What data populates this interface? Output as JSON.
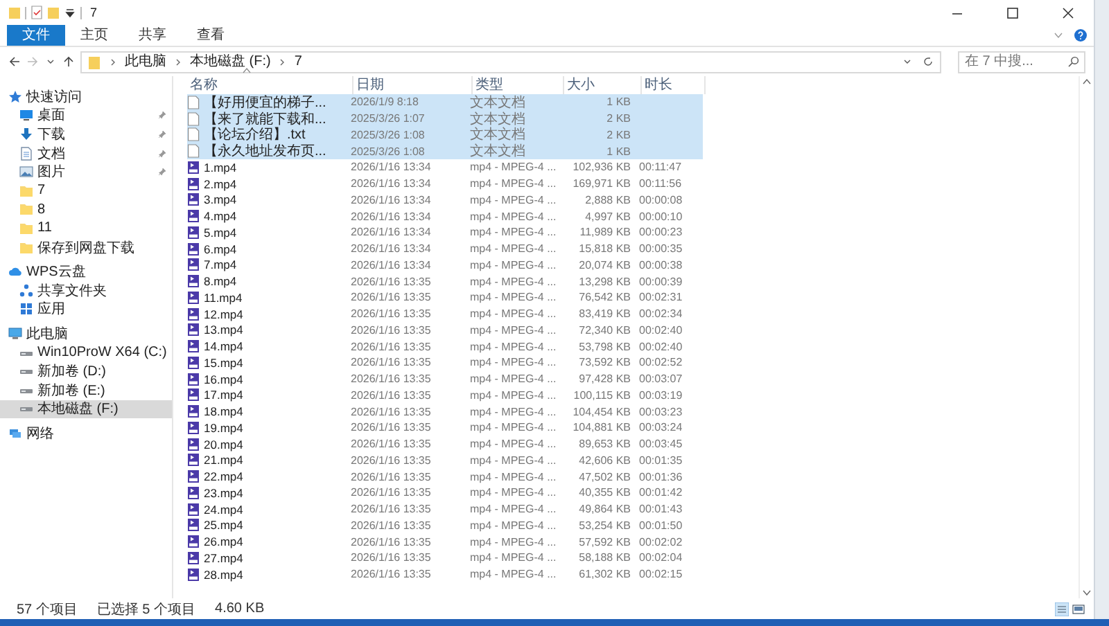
{
  "window": {
    "title": "7"
  },
  "ribbon_tabs": [
    {
      "label": "文件",
      "selected": true
    },
    {
      "label": "主页",
      "selected": false
    },
    {
      "label": "共享",
      "selected": false
    },
    {
      "label": "查看",
      "selected": false
    }
  ],
  "address": {
    "crumbs": [
      "此电脑",
      "本地磁盘 (F:)",
      "7"
    ]
  },
  "search": {
    "placeholder": "在 7 中搜..."
  },
  "sidebar": {
    "items": [
      {
        "label": "快速访问",
        "selected": false,
        "children": [
          {
            "label": "桌面",
            "pinned": true,
            "selected": false
          },
          {
            "label": "下载",
            "pinned": true,
            "selected": false
          },
          {
            "label": "文档",
            "pinned": true,
            "selected": false
          },
          {
            "label": "图片",
            "pinned": true,
            "selected": false
          },
          {
            "label": "7",
            "pinned": false,
            "selected": false
          },
          {
            "label": "8",
            "pinned": false,
            "selected": false
          },
          {
            "label": "11",
            "pinned": false,
            "selected": false
          },
          {
            "label": "保存到网盘下载",
            "pinned": false,
            "selected": false
          }
        ]
      },
      {
        "label": "WPS云盘",
        "selected": false,
        "children": [
          {
            "label": "共享文件夹",
            "pinned": false,
            "selected": false
          },
          {
            "label": "应用",
            "pinned": false,
            "selected": false
          }
        ]
      },
      {
        "label": "此电脑",
        "selected": false,
        "children": [
          {
            "label": "Win10ProW X64 (C:)",
            "pinned": false,
            "selected": false
          },
          {
            "label": "新加卷 (D:)",
            "pinned": false,
            "selected": false
          },
          {
            "label": "新加卷 (E:)",
            "pinned": false,
            "selected": false
          },
          {
            "label": "本地磁盘 (F:)",
            "pinned": false,
            "selected": true
          }
        ]
      },
      {
        "label": "网络",
        "selected": false
      }
    ]
  },
  "table": {
    "columns": [
      "名称",
      "日期",
      "类型",
      "大小",
      "时长"
    ],
    "rows": [
      {
        "kind": "text",
        "selected": true,
        "name": "【好用便宜的梯子...",
        "date": "2026/1/9 8:18",
        "type": "文本文档",
        "size": "1 KB"
      },
      {
        "kind": "text",
        "selected": true,
        "name": "【来了就能下载和...",
        "date": "2025/3/26 1:07",
        "type": "文本文档",
        "size": "2 KB"
      },
      {
        "kind": "text",
        "selected": true,
        "name": "【论坛介绍】.txt",
        "date": "2025/3/26 1:08",
        "type": "文本文档",
        "size": "2 KB"
      },
      {
        "kind": "text",
        "selected": true,
        "name": "【永久地址发布页...",
        "date": "2025/3/26 1:08",
        "type": "文本文档",
        "size": "1 KB"
      },
      {
        "kind": "video",
        "selected": false,
        "name": "1.mp4",
        "date": "2026/1/16 13:34",
        "type": "mp4 - MPEG-4 ...",
        "size": "102,936 KB",
        "duration": "00:11:47"
      },
      {
        "kind": "video",
        "selected": false,
        "name": "2.mp4",
        "date": "2026/1/16 13:34",
        "type": "mp4 - MPEG-4 ...",
        "size": "169,971 KB",
        "duration": "00:11:56"
      },
      {
        "kind": "video",
        "selected": false,
        "name": "3.mp4",
        "date": "2026/1/16 13:34",
        "type": "mp4 - MPEG-4 ...",
        "size": "2,888 KB",
        "duration": "00:00:08"
      },
      {
        "kind": "video",
        "selected": false,
        "name": "4.mp4",
        "date": "2026/1/16 13:34",
        "type": "mp4 - MPEG-4 ...",
        "size": "4,997 KB",
        "duration": "00:00:10"
      },
      {
        "kind": "video",
        "selected": false,
        "name": "5.mp4",
        "date": "2026/1/16 13:34",
        "type": "mp4 - MPEG-4 ...",
        "size": "11,989 KB",
        "duration": "00:00:23"
      },
      {
        "kind": "video",
        "selected": false,
        "name": "6.mp4",
        "date": "2026/1/16 13:34",
        "type": "mp4 - MPEG-4 ...",
        "size": "15,818 KB",
        "duration": "00:00:35"
      },
      {
        "kind": "video",
        "selected": false,
        "name": "7.mp4",
        "date": "2026/1/16 13:34",
        "type": "mp4 - MPEG-4 ...",
        "size": "20,074 KB",
        "duration": "00:00:38"
      },
      {
        "kind": "video",
        "selected": false,
        "name": "8.mp4",
        "date": "2026/1/16 13:35",
        "type": "mp4 - MPEG-4 ...",
        "size": "13,298 KB",
        "duration": "00:00:39"
      },
      {
        "kind": "video",
        "selected": false,
        "name": "11.mp4",
        "date": "2026/1/16 13:35",
        "type": "mp4 - MPEG-4 ...",
        "size": "76,542 KB",
        "duration": "00:02:31"
      },
      {
        "kind": "video",
        "selected": false,
        "name": "12.mp4",
        "date": "2026/1/16 13:35",
        "type": "mp4 - MPEG-4 ...",
        "size": "83,419 KB",
        "duration": "00:02:34"
      },
      {
        "kind": "video",
        "selected": false,
        "name": "13.mp4",
        "date": "2026/1/16 13:35",
        "type": "mp4 - MPEG-4 ...",
        "size": "72,340 KB",
        "duration": "00:02:40"
      },
      {
        "kind": "video",
        "selected": false,
        "name": "14.mp4",
        "date": "2026/1/16 13:35",
        "type": "mp4 - MPEG-4 ...",
        "size": "53,798 KB",
        "duration": "00:02:40"
      },
      {
        "kind": "video",
        "selected": false,
        "name": "15.mp4",
        "date": "2026/1/16 13:35",
        "type": "mp4 - MPEG-4 ...",
        "size": "73,592 KB",
        "duration": "00:02:52"
      },
      {
        "kind": "video",
        "selected": false,
        "name": "16.mp4",
        "date": "2026/1/16 13:35",
        "type": "mp4 - MPEG-4 ...",
        "size": "97,428 KB",
        "duration": "00:03:07"
      },
      {
        "kind": "video",
        "selected": false,
        "name": "17.mp4",
        "date": "2026/1/16 13:35",
        "type": "mp4 - MPEG-4 ...",
        "size": "100,115 KB",
        "duration": "00:03:19"
      },
      {
        "kind": "video",
        "selected": false,
        "name": "18.mp4",
        "date": "2026/1/16 13:35",
        "type": "mp4 - MPEG-4 ...",
        "size": "104,454 KB",
        "duration": "00:03:23"
      },
      {
        "kind": "video",
        "selected": false,
        "name": "19.mp4",
        "date": "2026/1/16 13:35",
        "type": "mp4 - MPEG-4 ...",
        "size": "104,881 KB",
        "duration": "00:03:24"
      },
      {
        "kind": "video",
        "selected": false,
        "name": "20.mp4",
        "date": "2026/1/16 13:35",
        "type": "mp4 - MPEG-4 ...",
        "size": "89,653 KB",
        "duration": "00:03:45"
      },
      {
        "kind": "video",
        "selected": false,
        "name": "21.mp4",
        "date": "2026/1/16 13:35",
        "type": "mp4 - MPEG-4 ...",
        "size": "42,606 KB",
        "duration": "00:01:35"
      },
      {
        "kind": "video",
        "selected": false,
        "name": "22.mp4",
        "date": "2026/1/16 13:35",
        "type": "mp4 - MPEG-4 ...",
        "size": "47,502 KB",
        "duration": "00:01:36"
      },
      {
        "kind": "video",
        "selected": false,
        "name": "23.mp4",
        "date": "2026/1/16 13:35",
        "type": "mp4 - MPEG-4 ...",
        "size": "40,355 KB",
        "duration": "00:01:42"
      },
      {
        "kind": "video",
        "selected": false,
        "name": "24.mp4",
        "date": "2026/1/16 13:35",
        "type": "mp4 - MPEG-4 ...",
        "size": "49,864 KB",
        "duration": "00:01:43"
      },
      {
        "kind": "video",
        "selected": false,
        "name": "25.mp4",
        "date": "2026/1/16 13:35",
        "type": "mp4 - MPEG-4 ...",
        "size": "53,254 KB",
        "duration": "00:01:50"
      },
      {
        "kind": "video",
        "selected": false,
        "name": "26.mp4",
        "date": "2026/1/16 13:35",
        "type": "mp4 - MPEG-4 ...",
        "size": "57,592 KB",
        "duration": "00:02:02"
      },
      {
        "kind": "video",
        "selected": false,
        "name": "27.mp4",
        "date": "2026/1/16 13:35",
        "type": "mp4 - MPEG-4 ...",
        "size": "58,188 KB",
        "duration": "00:02:04"
      },
      {
        "kind": "video",
        "selected": false,
        "name": "28.mp4",
        "date": "2026/1/16 13:35",
        "type": "mp4 - MPEG-4 ...",
        "size": "61,302 KB",
        "duration": "00:02:15"
      }
    ]
  },
  "status_bar": {
    "count": "57 个项目",
    "selection": "已选择 5 个项目",
    "size": "4.60 KB"
  }
}
